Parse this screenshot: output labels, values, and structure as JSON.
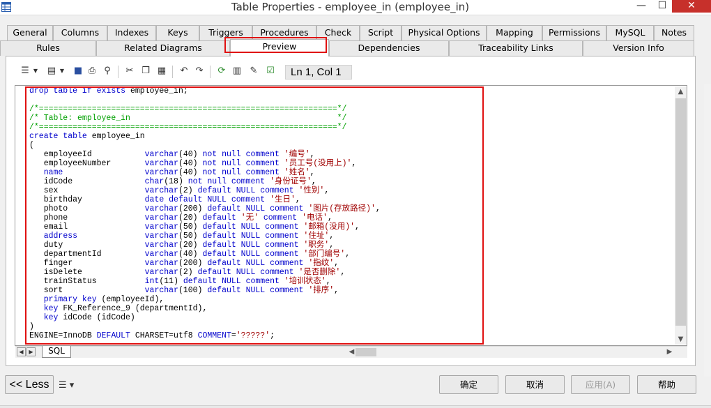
{
  "window": {
    "title": "Table Properties - employee_in (employee_in)",
    "min_glyph": "—",
    "max_glyph": "☐",
    "close_glyph": "✕"
  },
  "tabs_row1": [
    "General",
    "Columns",
    "Indexes",
    "Keys",
    "Triggers",
    "Procedures",
    "Check",
    "Script",
    "Physical Options",
    "Mapping",
    "Permissions",
    "MySQL",
    "Notes"
  ],
  "tabs_row2": [
    "Rules",
    "Related Diagrams",
    "Preview",
    "Dependencies",
    "Traceability Links",
    "Version Info"
  ],
  "active_tab": "Preview",
  "toolbar": {
    "icons": [
      "list-icon",
      "properties-icon",
      "save-icon",
      "print-icon",
      "find-icon",
      "cut-icon",
      "copy-icon",
      "paste-icon",
      "undo-icon",
      "redo-icon",
      "refresh-icon",
      "view-icon",
      "edit-icon",
      "check-icon"
    ],
    "position": "Ln 1, Col 1"
  },
  "code_lines": [
    [
      {
        "t": "drop table if exists ",
        "c": "k"
      },
      {
        "t": "employee_in;",
        "c": ""
      }
    ],
    [],
    [
      {
        "t": "/*==============================================================*/",
        "c": "c"
      }
    ],
    [
      {
        "t": "/* Table: employee_in                                           */",
        "c": "c"
      }
    ],
    [
      {
        "t": "/*==============================================================*/",
        "c": "c"
      }
    ],
    [
      {
        "t": "create table ",
        "c": "k"
      },
      {
        "t": "employee_in",
        "c": ""
      }
    ],
    [
      {
        "t": "(",
        "c": ""
      }
    ],
    [
      {
        "t": "   employeeId           ",
        "c": ""
      },
      {
        "t": "varchar",
        "c": "k"
      },
      {
        "t": "(40) ",
        "c": ""
      },
      {
        "t": "not null comment ",
        "c": "k"
      },
      {
        "t": "'编号'",
        "c": "s"
      },
      {
        "t": ",",
        "c": ""
      }
    ],
    [
      {
        "t": "   employeeNumber       ",
        "c": ""
      },
      {
        "t": "varchar",
        "c": "k"
      },
      {
        "t": "(40) ",
        "c": ""
      },
      {
        "t": "not null comment ",
        "c": "k"
      },
      {
        "t": "'员工号(没用上)'",
        "c": "s"
      },
      {
        "t": ",",
        "c": ""
      }
    ],
    [
      {
        "t": "   ",
        "c": ""
      },
      {
        "t": "name",
        "c": "k"
      },
      {
        "t": "                 ",
        "c": ""
      },
      {
        "t": "varchar",
        "c": "k"
      },
      {
        "t": "(40) ",
        "c": ""
      },
      {
        "t": "not null comment ",
        "c": "k"
      },
      {
        "t": "'姓名'",
        "c": "s"
      },
      {
        "t": ",",
        "c": ""
      }
    ],
    [
      {
        "t": "   idCode               ",
        "c": ""
      },
      {
        "t": "char",
        "c": "k"
      },
      {
        "t": "(18) ",
        "c": ""
      },
      {
        "t": "not null comment ",
        "c": "k"
      },
      {
        "t": "'身份证号'",
        "c": "s"
      },
      {
        "t": ",",
        "c": ""
      }
    ],
    [
      {
        "t": "   sex                  ",
        "c": ""
      },
      {
        "t": "varchar",
        "c": "k"
      },
      {
        "t": "(2) ",
        "c": ""
      },
      {
        "t": "default NULL comment ",
        "c": "k"
      },
      {
        "t": "'性别'",
        "c": "s"
      },
      {
        "t": ",",
        "c": ""
      }
    ],
    [
      {
        "t": "   birthday             ",
        "c": ""
      },
      {
        "t": "date default NULL comment ",
        "c": "k"
      },
      {
        "t": "'生日'",
        "c": "s"
      },
      {
        "t": ",",
        "c": ""
      }
    ],
    [
      {
        "t": "   photo                ",
        "c": ""
      },
      {
        "t": "varchar",
        "c": "k"
      },
      {
        "t": "(200) ",
        "c": ""
      },
      {
        "t": "default NULL comment ",
        "c": "k"
      },
      {
        "t": "'图片(存放路径)'",
        "c": "s"
      },
      {
        "t": ",",
        "c": ""
      }
    ],
    [
      {
        "t": "   phone                ",
        "c": ""
      },
      {
        "t": "varchar",
        "c": "k"
      },
      {
        "t": "(20) ",
        "c": ""
      },
      {
        "t": "default ",
        "c": "k"
      },
      {
        "t": "'无'",
        "c": "s"
      },
      {
        "t": " comment ",
        "c": "k"
      },
      {
        "t": "'电话'",
        "c": "s"
      },
      {
        "t": ",",
        "c": ""
      }
    ],
    [
      {
        "t": "   email                ",
        "c": ""
      },
      {
        "t": "varchar",
        "c": "k"
      },
      {
        "t": "(50) ",
        "c": ""
      },
      {
        "t": "default NULL comment ",
        "c": "k"
      },
      {
        "t": "'邮箱(没用)'",
        "c": "s"
      },
      {
        "t": ",",
        "c": ""
      }
    ],
    [
      {
        "t": "   ",
        "c": ""
      },
      {
        "t": "address",
        "c": "k"
      },
      {
        "t": "              ",
        "c": ""
      },
      {
        "t": "varchar",
        "c": "k"
      },
      {
        "t": "(50) ",
        "c": ""
      },
      {
        "t": "default NULL comment ",
        "c": "k"
      },
      {
        "t": "'住址'",
        "c": "s"
      },
      {
        "t": ",",
        "c": ""
      }
    ],
    [
      {
        "t": "   duty                 ",
        "c": ""
      },
      {
        "t": "varchar",
        "c": "k"
      },
      {
        "t": "(20) ",
        "c": ""
      },
      {
        "t": "default NULL comment ",
        "c": "k"
      },
      {
        "t": "'职务'",
        "c": "s"
      },
      {
        "t": ",",
        "c": ""
      }
    ],
    [
      {
        "t": "   departmentId         ",
        "c": ""
      },
      {
        "t": "varchar",
        "c": "k"
      },
      {
        "t": "(40) ",
        "c": ""
      },
      {
        "t": "default NULL comment ",
        "c": "k"
      },
      {
        "t": "'部门编号'",
        "c": "s"
      },
      {
        "t": ",",
        "c": ""
      }
    ],
    [
      {
        "t": "   finger               ",
        "c": ""
      },
      {
        "t": "varchar",
        "c": "k"
      },
      {
        "t": "(200) ",
        "c": ""
      },
      {
        "t": "default NULL comment ",
        "c": "k"
      },
      {
        "t": "'指纹'",
        "c": "s"
      },
      {
        "t": ",",
        "c": ""
      }
    ],
    [
      {
        "t": "   isDelete             ",
        "c": ""
      },
      {
        "t": "varchar",
        "c": "k"
      },
      {
        "t": "(2) ",
        "c": ""
      },
      {
        "t": "default NULL comment ",
        "c": "k"
      },
      {
        "t": "'是否删除'",
        "c": "s"
      },
      {
        "t": ",",
        "c": ""
      }
    ],
    [
      {
        "t": "   trainStatus          ",
        "c": ""
      },
      {
        "t": "int",
        "c": "k"
      },
      {
        "t": "(11) ",
        "c": ""
      },
      {
        "t": "default NULL comment ",
        "c": "k"
      },
      {
        "t": "'培训状态'",
        "c": "s"
      },
      {
        "t": ",",
        "c": ""
      }
    ],
    [
      {
        "t": "   sort                 ",
        "c": ""
      },
      {
        "t": "varchar",
        "c": "k"
      },
      {
        "t": "(100) ",
        "c": ""
      },
      {
        "t": "default NULL comment ",
        "c": "k"
      },
      {
        "t": "'排序'",
        "c": "s"
      },
      {
        "t": ",",
        "c": ""
      }
    ],
    [
      {
        "t": "   primary key ",
        "c": "k"
      },
      {
        "t": "(employeeId),",
        "c": ""
      }
    ],
    [
      {
        "t": "   key ",
        "c": "k"
      },
      {
        "t": "FK_Reference_9 (departmentId),",
        "c": ""
      }
    ],
    [
      {
        "t": "   key ",
        "c": "k"
      },
      {
        "t": "idCode (idCode)",
        "c": ""
      }
    ],
    [
      {
        "t": ")",
        "c": ""
      }
    ],
    [
      {
        "t": "ENGINE=InnoDB ",
        "c": ""
      },
      {
        "t": "DEFAULT ",
        "c": "k"
      },
      {
        "t": "CHARSET=utf8 ",
        "c": ""
      },
      {
        "t": "COMMENT",
        "c": "k"
      },
      {
        "t": "=",
        "c": ""
      },
      {
        "t": "'?????'",
        "c": "s"
      },
      {
        "t": ";",
        "c": ""
      }
    ]
  ],
  "sheet_tab": "SQL",
  "buttons": {
    "less": "<< Less",
    "ok": "确定",
    "cancel": "取消",
    "apply": "应用(A)",
    "help": "帮助"
  },
  "colors": {
    "keyword": "#0000cc",
    "comment": "#00a000",
    "string": "#a00000",
    "highlight": "#e01010",
    "close": "#c7302b"
  }
}
